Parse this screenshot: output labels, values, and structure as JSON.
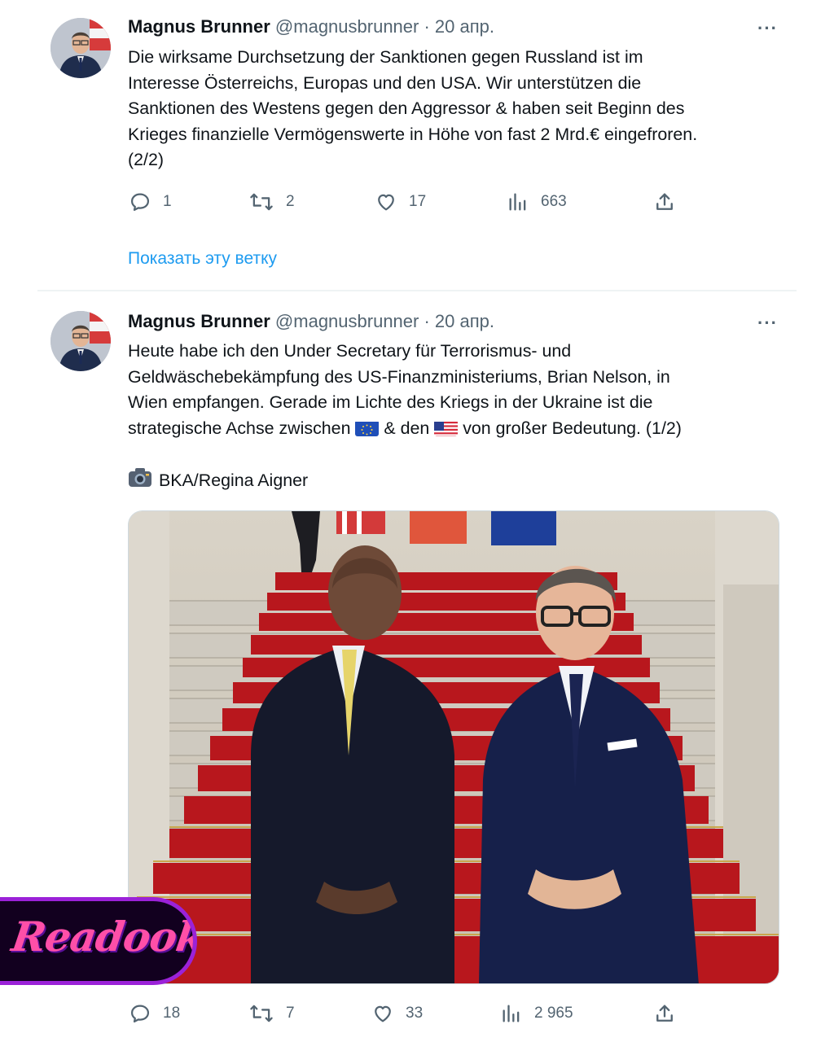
{
  "tweets": [
    {
      "author_name": "Magnus Brunner",
      "author_handle": "@magnusbrunner",
      "date": "· 20 апр.",
      "more_label": "···",
      "text_lines": [
        "Die wirksame Durchsetzung der Sanktionen gegen Russland ist im",
        "Interesse Österreichs, Europas und den USA. Wir unterstützen die",
        "Sanktionen des Westens gegen den Aggressor & haben seit Beginn des",
        "Krieges finanzielle Vermögenswerte in Höhe von fast 2 Mrd.€ eingefroren.",
        "(2/2)"
      ],
      "stats": {
        "replies": "1",
        "retweets": "2",
        "likes": "17",
        "views": "663"
      },
      "show_thread_label": "Показать эту ветку"
    },
    {
      "author_name": "Magnus Brunner",
      "author_handle": "@magnusbrunner",
      "date": "· 20 апр.",
      "more_label": "···",
      "text_lines": [
        "Heute habe ich den Under Secretary für Terrorismus- und",
        "Geldwäschebekämpfung des US-Finanzministeriums, Brian Nelson, in",
        "Wien empfangen. Gerade im Lichte des Kriegs in der Ukraine ist die"
      ],
      "text_line4": {
        "before": "strategische Achse zwischen",
        "middle": "& den",
        "after": "von großer Bedeutung. (1/2)"
      },
      "flags": [
        "eu-flag-emoji",
        "us-flag-emoji"
      ],
      "photo_credit": "BKA/Regina Aigner",
      "credit_icon": "camera-icon",
      "stats": {
        "replies": "18",
        "retweets": "7",
        "likes": "33",
        "views": "2 965"
      }
    }
  ],
  "watermark": {
    "text": "Readooka"
  },
  "colors": {
    "link": "#1d9bf0",
    "muted": "#536471",
    "text": "#0f1419",
    "watermark_border": "#9b22d8",
    "watermark_text": "#ff4fa8"
  }
}
